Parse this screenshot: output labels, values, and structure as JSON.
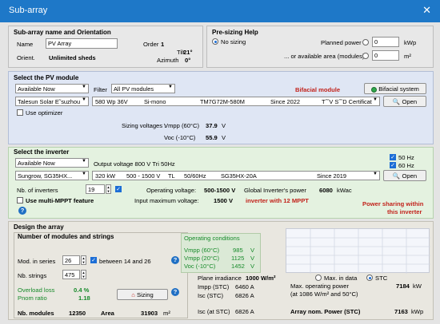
{
  "window": {
    "title": "Sub-array",
    "close": "✕"
  },
  "subarray": {
    "header": "Sub-array name and Orientation",
    "name_label": "Name",
    "name_value": "PV Array",
    "order_label": "Order",
    "order_value": "1",
    "orient_label": "Orient.",
    "orient_value": "Unlimited sheds",
    "tilt_label": "Tilt",
    "tilt_value": "21°",
    "azimuth_label": "Azimuth",
    "azimuth_value": "0°"
  },
  "presizing": {
    "header": "Pre-sizing Help",
    "no_sizing": "No sizing",
    "planned_power_label": "Planned power",
    "planned_power_value": "0",
    "planned_power_unit": "kWp",
    "area_label": "... or available area (modules)",
    "area_value": "0",
    "area_unit": "m²"
  },
  "pv_module": {
    "header": "Select the PV module",
    "availability": "Available Now",
    "filter_label": "Filter",
    "filter_value": "All PV modules",
    "bifacial_label": "Bifacial module",
    "bifacial_system_button": "Bifacial system",
    "manufacturer": "Talesun Solar Ε˜suzhou",
    "power": "580 Wp 36V",
    "tech": "Si-mono",
    "model": "TM7G72M-580M",
    "since": "Since 2022",
    "cert": "T˝ˆV S˝ˆD Certificat",
    "open_button": "Open",
    "use_optimizer": "Use optimizer",
    "sizing_voltages_label": "Sizing voltages :",
    "vmpp_label": "Vmpp (60°C)",
    "vmpp_value": "37.9",
    "vmpp_unit": "V",
    "voc_label": "Voc (-10°C)",
    "voc_value": "55.9",
    "voc_unit": "V"
  },
  "inverter": {
    "header": "Select the inverter",
    "availability": "Available Now",
    "output_voltage": "Output voltage 800 V Tri 50Hz",
    "hz50": "50 Hz",
    "hz60": "60 Hz",
    "manufacturer": "Sungrow, SG35HX...",
    "power": "320 kW",
    "voltage_range": "500 - 1500 V",
    "tl": "TL",
    "freq": "50/60Hz",
    "model": "SG35HX-20A",
    "since": "Since 2019",
    "open_button": "Open",
    "nb_inverters_label": "Nb. of inverters",
    "nb_inverters_value": "19",
    "operating_voltage_label": "Operating voltage:",
    "operating_voltage_value": "500-1500 V",
    "global_power_label": "Global Inverter's power",
    "global_power_value": "6080",
    "global_power_unit": "kWac",
    "multi_mppt": "Use multi-MPPT feature",
    "input_max_voltage_label": "Input maximum voltage:",
    "input_max_voltage_value": "1500 V",
    "mppt_note": "inverter with 12 MPPT",
    "power_sharing_line1": "Power sharing within",
    "power_sharing_line2": "this inverter"
  },
  "design": {
    "header": "Design the array",
    "subheader": "Number of modules and strings",
    "mod_series_label": "Mod. in series",
    "mod_series_value": "26",
    "between_label": "between 14 and 26",
    "nb_strings_label": "Nb. strings",
    "nb_strings_value": "475",
    "overload_label": "Overload loss",
    "overload_value": "0.4 %",
    "pnom_label": "Pnom ratio",
    "pnom_value": "1.18",
    "sizing_button": "Sizing",
    "nb_modules_label": "Nb. modules",
    "nb_modules_value": "12350",
    "area_label": "Area",
    "area_value": "31903",
    "area_unit": "m²",
    "op_conditions_header": "Operating conditions",
    "op_rows": [
      {
        "label": "Vmpp (60°C)",
        "value": "985",
        "unit": "V"
      },
      {
        "label": "Vmpp (20°C)",
        "value": "1125",
        "unit": "V"
      },
      {
        "label": "Voc (-10°C)",
        "value": "1452",
        "unit": "V"
      }
    ],
    "plane_irr_label": "Plane irradiance",
    "plane_irr_value": "1000 W/m²",
    "max_in_data": "Max. in data",
    "stc": "STC",
    "impp_label": "Impp (STC)",
    "impp_value": "6460 A",
    "isc_label": "Isc (STC)",
    "isc_value": "6826 A",
    "max_op_power_label": "Max. operating power",
    "max_op_power_sub": "(at 1086 W/m² and 50°C)",
    "max_op_power_value": "7184",
    "max_op_power_unit": "kW",
    "isc_at_stc_label": "Isc (at STC)",
    "isc_at_stc_value": "6826 A",
    "array_nom_label": "Array nom. Power (STC)",
    "array_nom_value": "7163",
    "array_nom_unit": "kWp"
  },
  "icons": {
    "close": "close-icon",
    "open": "magnifier-icon",
    "help": "question-icon",
    "bifacial": "status-led-icon",
    "sizing": "chart-icon"
  },
  "colors": {
    "titlebar": "#1e78c8",
    "module_panel": "#dfe6f4",
    "inverter_panel": "#e4f2e0",
    "design_panel": "#e9e7e0",
    "accent_red": "#c2221b",
    "accent_green": "#178a2a",
    "check_blue": "#1c6ed6"
  }
}
